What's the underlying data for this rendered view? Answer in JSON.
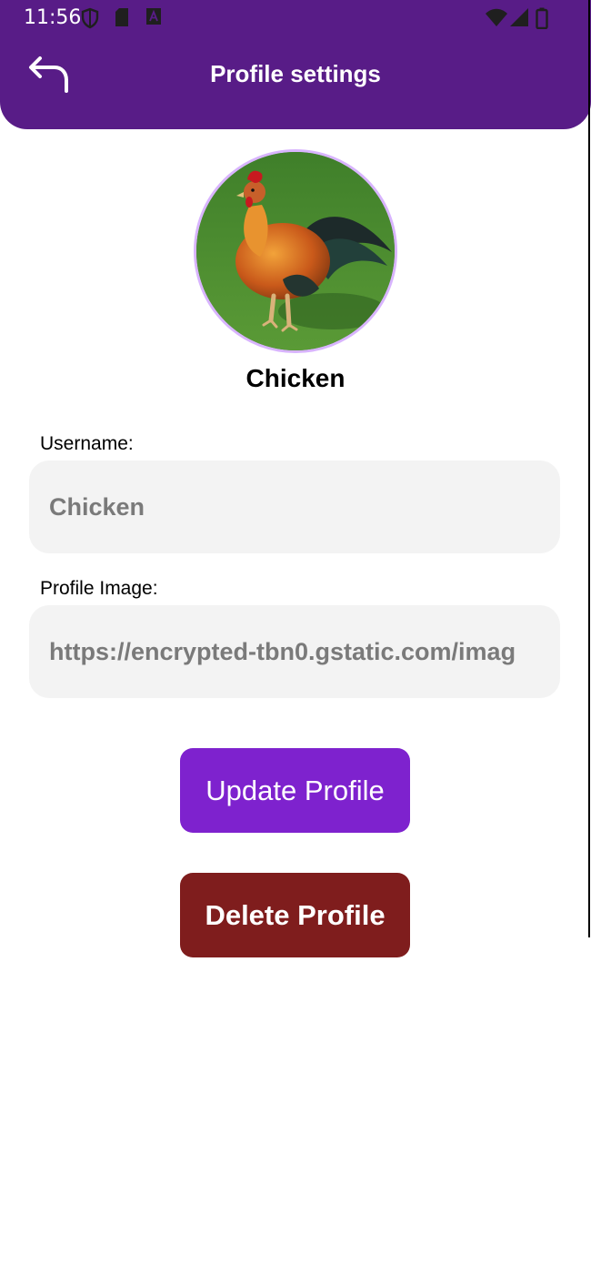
{
  "status_bar": {
    "time": "11:56",
    "left_icons": [
      "shield-icon",
      "sd-card-icon",
      "a-box-icon"
    ],
    "right_icons": [
      "wifi-icon",
      "signal-icon",
      "battery-icon"
    ]
  },
  "header": {
    "title": "Profile settings",
    "back_icon": "back-arrow-icon",
    "background": "#581c87"
  },
  "profile": {
    "display_name": "Chicken",
    "avatar_border": "#d8b4fe"
  },
  "form": {
    "username": {
      "label": "Username:",
      "value": "Chicken"
    },
    "profile_image": {
      "label": "Profile Image:",
      "value": "https://encrypted-tbn0.gstatic.com/imag"
    }
  },
  "actions": {
    "update_label": "Update Profile",
    "update_color": "#7e22ce",
    "delete_label": "Delete Profile",
    "delete_color": "#7f1d1d"
  }
}
